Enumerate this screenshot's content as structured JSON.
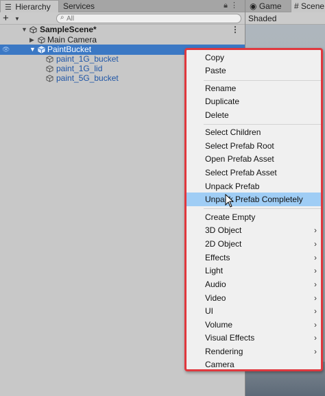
{
  "hierarchy": {
    "tabs": {
      "hierarchy": "Hierarchy",
      "services": "Services"
    },
    "search": {
      "placeholder": "All"
    },
    "scene_name": "SampleScene*",
    "items": {
      "main_camera": "Main Camera",
      "paint_bucket": "PaintBucket",
      "child1": "paint_1G_bucket",
      "child2": "paint_1G_lid",
      "child3": "paint_5G_bucket"
    }
  },
  "scene_panel": {
    "tabs": {
      "game": "Game",
      "scene": "Scene"
    },
    "shading": "Shaded"
  },
  "context_menu": {
    "copy": "Copy",
    "paste": "Paste",
    "rename": "Rename",
    "duplicate": "Duplicate",
    "delete": "Delete",
    "select_children": "Select Children",
    "select_prefab_root": "Select Prefab Root",
    "open_prefab_asset": "Open Prefab Asset",
    "select_prefab_asset": "Select Prefab Asset",
    "unpack_prefab": "Unpack Prefab",
    "unpack_prefab_completely": "Unpack Prefab Completely",
    "create_empty": "Create Empty",
    "object_3d": "3D Object",
    "object_2d": "2D Object",
    "effects": "Effects",
    "light": "Light",
    "audio": "Audio",
    "video": "Video",
    "ui": "UI",
    "volume": "Volume",
    "visual_effects": "Visual Effects",
    "rendering": "Rendering",
    "camera": "Camera",
    "highlighted_item": "Unpack Prefab Completely"
  },
  "colors": {
    "selection": "#3b78c4",
    "menu_highlight": "#9fcdf5",
    "annotation_border": "#e0383e",
    "prefab_text": "#1e55a6"
  }
}
